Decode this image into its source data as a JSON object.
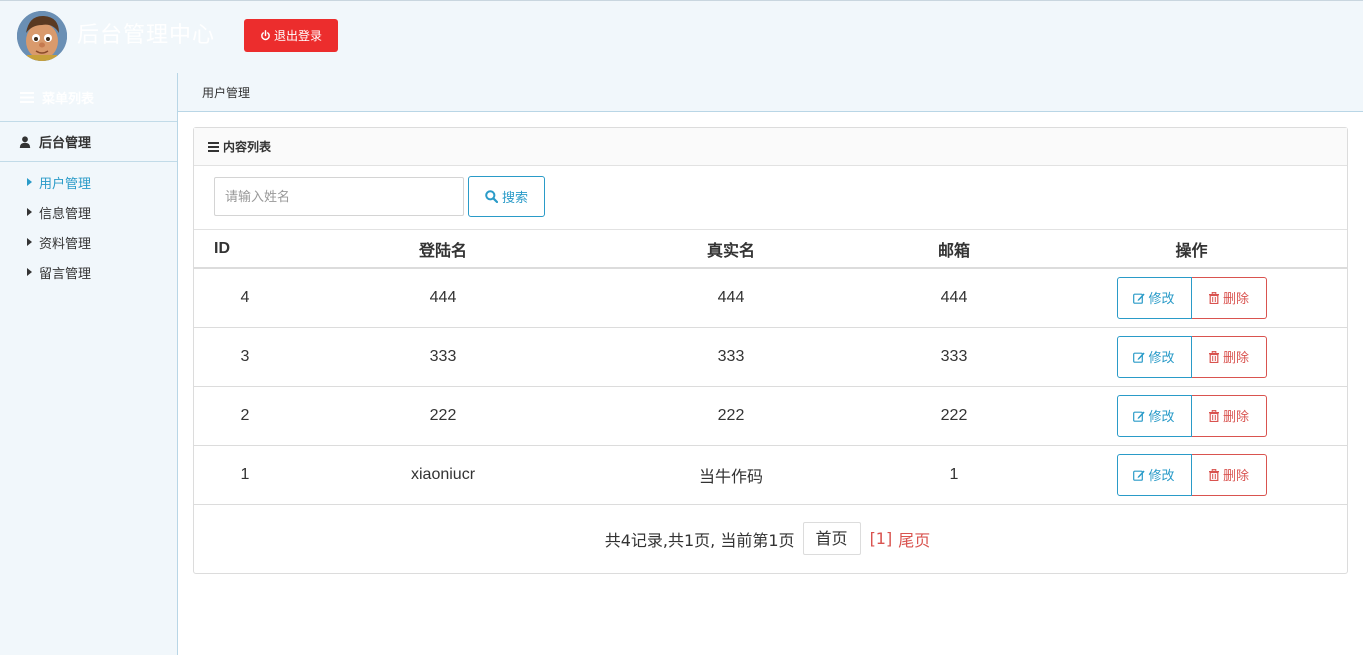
{
  "header": {
    "title": "后台管理中心",
    "logout_label": "退出登录"
  },
  "sidebar": {
    "menu_title": "菜单列表",
    "group_label": "后台管理",
    "items": [
      {
        "label": "用户管理",
        "active": true
      },
      {
        "label": "信息管理",
        "active": false
      },
      {
        "label": "资料管理",
        "active": false
      },
      {
        "label": "留言管理",
        "active": false
      }
    ]
  },
  "breadcrumb": "用户管理",
  "panel": {
    "title": "内容列表",
    "search": {
      "placeholder": "请输入姓名",
      "value": "",
      "button_label": "搜索"
    },
    "table": {
      "columns": [
        "ID",
        "登陆名",
        "真实名",
        "邮箱",
        "操作"
      ],
      "rows": [
        {
          "id": "4",
          "login": "444",
          "realname": "444",
          "email": "444"
        },
        {
          "id": "3",
          "login": "333",
          "realname": "333",
          "email": "333"
        },
        {
          "id": "2",
          "login": "222",
          "realname": "222",
          "email": "222"
        },
        {
          "id": "1",
          "login": "xiaoniucr",
          "realname": "当牛作码",
          "email": "1"
        }
      ],
      "edit_label": "修改",
      "delete_label": "删除"
    },
    "pager": {
      "info": "共4记录,共1页, 当前第1页",
      "first_label": "首页",
      "current_page": "[1]",
      "last_label": "尾页"
    }
  },
  "colors": {
    "accent": "#2a9bc8",
    "danger": "#d9534f",
    "logout": "#ec2d2d",
    "sidebar_bg": "#f1f7fb"
  },
  "icons": [
    "power-icon",
    "list-icon",
    "user-icon",
    "caret-right-icon",
    "search-icon",
    "edit-icon",
    "trash-icon"
  ]
}
